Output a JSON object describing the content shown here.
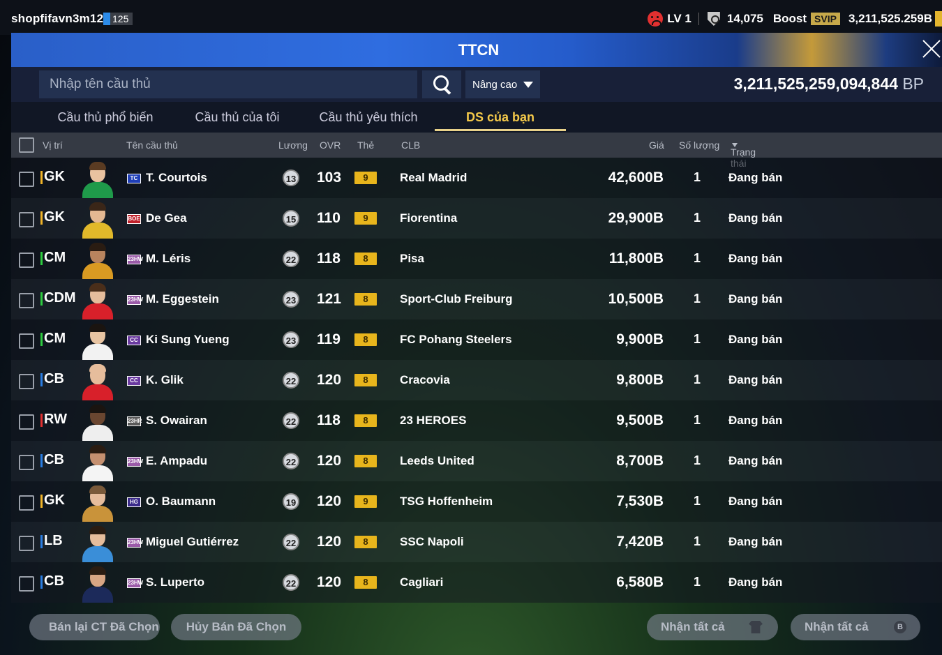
{
  "topbar": {
    "username": "shopfifavn3m121",
    "user_badge": "125",
    "level": "LV 1",
    "points": "14,075",
    "boost": "Boost",
    "svip": "SVIP",
    "coins": "3,211,525.259B"
  },
  "panel": {
    "title": "TTCN",
    "search_placeholder": "Nhập tên cầu thủ",
    "advanced_label": "Nâng cao",
    "bp_total": "3,211,525,259,094,844",
    "bp_unit": "BP"
  },
  "tabs": [
    {
      "label": "Cầu thủ phổ biến"
    },
    {
      "label": "Cầu thủ của tôi"
    },
    {
      "label": "Cầu thủ yêu thích"
    },
    {
      "label": "DS của bạn"
    }
  ],
  "columns": {
    "position": "Vị trí",
    "name": "Tên cầu thủ",
    "salary": "Lương",
    "ovr": "OVR",
    "card": "Thẻ",
    "club": "CLB",
    "price": "Giá",
    "quantity": "Số lượng",
    "status": "Trạng thái"
  },
  "players": [
    {
      "pos": "GK",
      "pos_color": "#f0b429",
      "season": "TC",
      "season_color": "#1f3fb8",
      "name": "T. Courtois",
      "salary": "13",
      "ovr": "103",
      "grade": "9",
      "club": "Real Madrid",
      "price": "42,600B",
      "qty": "1",
      "status": "Đang bán",
      "kit": "#1f9a4a",
      "skin": "#e9c2a0",
      "hair": "#5a3b22"
    },
    {
      "pos": "GK",
      "pos_color": "#f0b429",
      "season": "BOE",
      "season_color": "#c0202a",
      "name": "De Gea",
      "salary": "15",
      "ovr": "110",
      "grade": "9",
      "club": "Fiorentina",
      "price": "29,900B",
      "qty": "1",
      "status": "Đang bán",
      "kit": "#e2b92a",
      "skin": "#e4b892",
      "hair": "#3a2618"
    },
    {
      "pos": "CM",
      "pos_color": "#2ecc40",
      "season": "23HW",
      "season_color": "#9a5aa8",
      "name": "M. Léris",
      "salary": "22",
      "ovr": "118",
      "grade": "8",
      "club": "Pisa",
      "price": "11,800B",
      "qty": "1",
      "status": "Đang bán",
      "kit": "#d99a22",
      "skin": "#b8845e",
      "hair": "#2a1c12"
    },
    {
      "pos": "CDM",
      "pos_color": "#2ecc40",
      "season": "23HW",
      "season_color": "#9a5aa8",
      "name": "M. Eggestein",
      "salary": "23",
      "ovr": "121",
      "grade": "8",
      "club": "Sport-Club Freiburg",
      "price": "10,500B",
      "qty": "1",
      "status": "Đang bán",
      "kit": "#d8202a",
      "skin": "#e6bd9c",
      "hair": "#4a2e1a"
    },
    {
      "pos": "CM",
      "pos_color": "#2ecc40",
      "season": "CC",
      "season_color": "#6a3aa0",
      "name": "Ki Sung Yueng",
      "salary": "23",
      "ovr": "119",
      "grade": "8",
      "club": "FC Pohang Steelers",
      "price": "9,900B",
      "qty": "1",
      "status": "Đang bán",
      "kit": "#f2f2f2",
      "skin": "#e8c4a2",
      "hair": "#1a1410"
    },
    {
      "pos": "CB",
      "pos_color": "#2a7de1",
      "season": "CC",
      "season_color": "#6a3aa0",
      "name": "K. Glik",
      "salary": "22",
      "ovr": "120",
      "grade": "8",
      "club": "Cracovia",
      "price": "9,800B",
      "qty": "1",
      "status": "Đang bán",
      "kit": "#d8202a",
      "skin": "#e6bd9c",
      "hair": "#e6bd9c"
    },
    {
      "pos": "RW",
      "pos_color": "#e23030",
      "season": "23HR",
      "season_color": "#5a5a5a",
      "name": "S. Owairan",
      "salary": "22",
      "ovr": "118",
      "grade": "8",
      "club": "23 HEROES",
      "price": "9,500B",
      "qty": "1",
      "status": "Đang bán",
      "kit": "#eeeeee",
      "skin": "#6a4630",
      "hair": "#1a1410"
    },
    {
      "pos": "CB",
      "pos_color": "#2a7de1",
      "season": "23HW",
      "season_color": "#9a5aa8",
      "name": "E. Ampadu",
      "salary": "22",
      "ovr": "120",
      "grade": "8",
      "club": "Leeds United",
      "price": "8,700B",
      "qty": "1",
      "status": "Đang bán",
      "kit": "#f4f4f4",
      "skin": "#c59070",
      "hair": "#2a1c12"
    },
    {
      "pos": "GK",
      "pos_color": "#f0b429",
      "season": "HG",
      "season_color": "#3a2a8a",
      "name": "O. Baumann",
      "salary": "19",
      "ovr": "120",
      "grade": "9",
      "club": "TSG Hoffenheim",
      "price": "7,530B",
      "qty": "1",
      "status": "Đang bán",
      "kit": "#c9933a",
      "skin": "#e6bd9c",
      "hair": "#7a5a3a"
    },
    {
      "pos": "LB",
      "pos_color": "#2a7de1",
      "season": "23HW",
      "season_color": "#9a5aa8",
      "name": "Miguel Gutiérrez",
      "salary": "22",
      "ovr": "120",
      "grade": "8",
      "club": "SSC Napoli",
      "price": "7,420B",
      "qty": "1",
      "status": "Đang bán",
      "kit": "#3a8ed8",
      "skin": "#e6bd9c",
      "hair": "#2a1c12"
    },
    {
      "pos": "CB",
      "pos_color": "#2a7de1",
      "season": "23HW",
      "season_color": "#9a5aa8",
      "name": "S. Luperto",
      "salary": "22",
      "ovr": "120",
      "grade": "8",
      "club": "Cagliari",
      "price": "6,580B",
      "qty": "1",
      "status": "Đang bán",
      "kit": "#1c2a5a",
      "skin": "#d8a684",
      "hair": "#2a1c12"
    }
  ],
  "footer": {
    "resell_selected": "Bán lại CT Đã Chọn",
    "cancel_selected": "Hủy Bán Đã Chọn",
    "receive_all_1": "Nhận tất cả",
    "receive_all_2": "Nhận tất cả",
    "coin_glyph": "B"
  }
}
